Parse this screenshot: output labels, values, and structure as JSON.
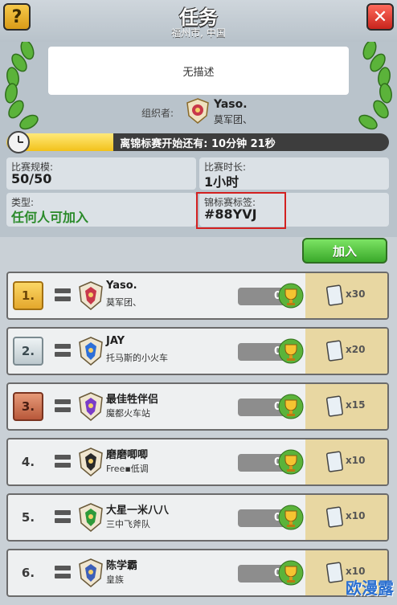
{
  "header": {
    "title": "任务",
    "location": "福州市, 中国",
    "help_label": "?",
    "close_label": "✕"
  },
  "description": "无描述",
  "organizer": {
    "label": "组织者:",
    "name": "Yaso.",
    "clan": "莫军团、"
  },
  "timer": {
    "text": "离锦标赛开始还有: 10分钟 21秒",
    "progress": 0.28
  },
  "info": {
    "size_label": "比赛规模:",
    "size_value": "50/50",
    "duration_label": "比赛时长:",
    "duration_value": "1小时",
    "type_label": "类型:",
    "type_value": "任何人可加入",
    "tag_label": "锦标赛标签:",
    "tag_value": "#88YVJ"
  },
  "join_label": "加入",
  "players": [
    {
      "rank": "1.",
      "name": "Yaso.",
      "clan": "莫军团、",
      "trophies": "0",
      "reward": "x30",
      "rank_style": "gold",
      "badge_color": "#c8384a"
    },
    {
      "rank": "2.",
      "name": "JAY",
      "clan": "托马斯的小火车",
      "trophies": "0",
      "reward": "x20",
      "rank_style": "silver",
      "badge_color": "#2e6fd8"
    },
    {
      "rank": "3.",
      "name": "最佳牲伴侣",
      "clan": "魔都火车站",
      "trophies": "0",
      "reward": "x15",
      "rank_style": "bronze",
      "badge_color": "#7a3cc8"
    },
    {
      "rank": "4.",
      "name": "磨磨唧唧",
      "clan": "Free▪低调",
      "trophies": "0",
      "reward": "x10",
      "rank_style": "plain",
      "badge_color": "#2a2a2a"
    },
    {
      "rank": "5.",
      "name": "大星一米八八",
      "clan": "三中飞斧队",
      "trophies": "0",
      "reward": "x10",
      "rank_style": "plain",
      "badge_color": "#2e9a3a"
    },
    {
      "rank": "6.",
      "name": "陈学霸",
      "clan": "皇族",
      "trophies": "0",
      "reward": "x10",
      "rank_style": "plain",
      "badge_color": "#3d5fb8"
    }
  ],
  "watermark": "欧漫露"
}
